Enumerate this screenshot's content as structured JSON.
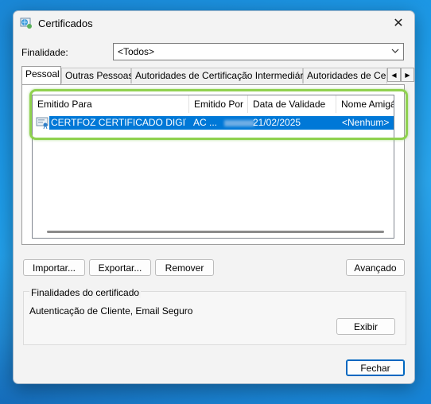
{
  "window": {
    "title": "Certificados",
    "close_glyph": "✕"
  },
  "finalidade": {
    "label": "Finalidade:",
    "selected": "<Todos>"
  },
  "tabs": [
    {
      "label": "Pessoal"
    },
    {
      "label": "Outras Pessoas"
    },
    {
      "label": "Autoridades de Certificação Intermediárias"
    },
    {
      "label": "Autoridades de Ce"
    }
  ],
  "tab_scroll": {
    "left": "◀",
    "right": "▶"
  },
  "list": {
    "columns": [
      "Emitido Para",
      "Emitido Por",
      "Data de Validade",
      "Nome Amigáve"
    ],
    "rows": [
      {
        "emitido_para": "CERTFOZ CERTIFICADO DIGITA...",
        "emitido_por": "AC        ...",
        "validade": "21/02/2025",
        "nome": "<Nenhum>"
      }
    ]
  },
  "buttons": {
    "importar": "Importar...",
    "exportar": "Exportar...",
    "remover": "Remover",
    "avancado": "Avançado",
    "exibir": "Exibir",
    "fechar": "Fechar"
  },
  "finalidades": {
    "title": "Finalidades do certificado",
    "value": "Autenticação de Cliente, Email Seguro"
  },
  "colors": {
    "selection": "#0078d7",
    "highlight": "#8fd14f",
    "default_button": "#0067c0"
  }
}
